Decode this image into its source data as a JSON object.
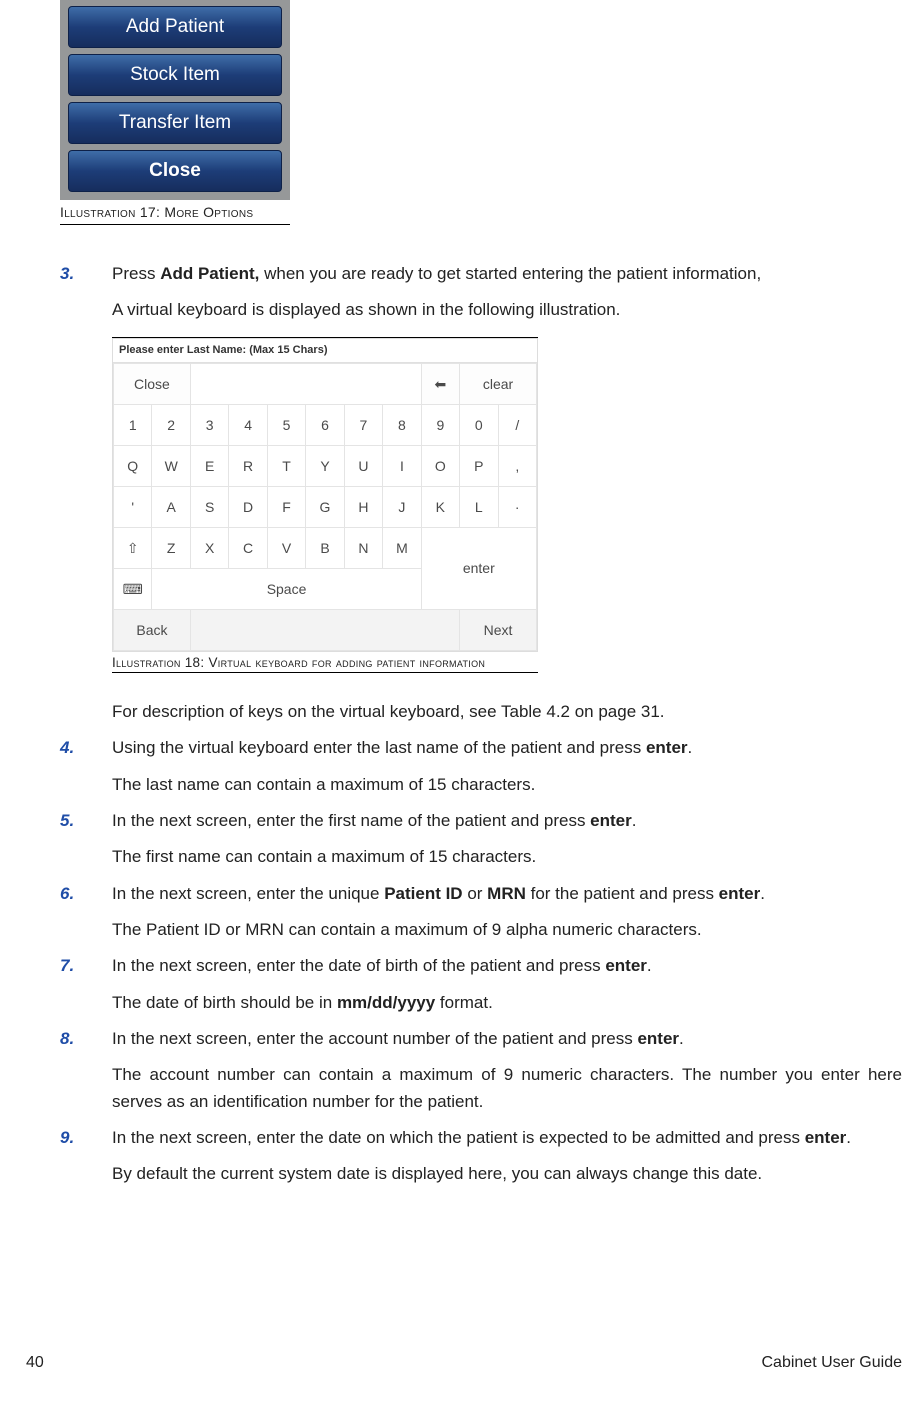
{
  "illustration17": {
    "buttons": [
      "Add Patient",
      "Stock Item",
      "Transfer Item",
      "Close"
    ],
    "caption": "Illustration 17: More Options"
  },
  "steps": {
    "s3": {
      "num": "3.",
      "text_a": "Press ",
      "bold_a": "Add Patient,",
      "text_b": " when you are ready to get started entering the patient information,",
      "line2": "A virtual keyboard is displayed as shown in the following illustration."
    },
    "s3_after": "For description of keys on the virtual keyboard, see Table 4.2 on page 31.",
    "s4": {
      "num": "4.",
      "line1a": "Using the virtual keyboard enter the last name of the patient and press ",
      "line1b": "enter",
      "line1c": ".",
      "line2": "The last name can contain a maximum of 15 characters."
    },
    "s5": {
      "num": "5.",
      "line1a": "In the next screen, enter the first name of the patient and  press  ",
      "line1b": "enter",
      "line1c": ".",
      "line2": "The first name can contain a maximum of 15 characters."
    },
    "s6": {
      "num": "6.",
      "line1a": "In the next screen, enter the unique ",
      "b1": "Patient ID",
      "mid1": " or ",
      "b2": "MRN",
      "mid2": " for the patient and press ",
      "b3": "enter",
      "end": ".",
      "line2": "The Patient ID or MRN  can contain a maximum of 9 alpha numeric characters."
    },
    "s7": {
      "num": "7.",
      "line1a": "In the next screen, enter the date of birth of the patient and press ",
      "line1b": "enter",
      "line1c": ".",
      "line2a": "The date of birth should be in ",
      "line2b": "mm/dd/yyyy",
      "line2c": " format."
    },
    "s8": {
      "num": "8.",
      "line1a": "In the next screen, enter the account number of the patient and press  ",
      "line1b": "enter",
      "line1c": ".",
      "line2": "The account number can contain a maximum of 9 numeric characters. The number you enter here serves as an identification number for the patient."
    },
    "s9": {
      "num": "9.",
      "line1a": "In the next screen, enter the date on which the patient is expected to be admitted and press ",
      "line1b": "enter",
      "line1c": ".",
      "line2": "By default the current system date is displayed here, you can always change this date."
    }
  },
  "illustration18": {
    "header": "Please enter Last Name: (Max 15 Chars)",
    "row1": {
      "close": "Close",
      "bksp": "⬅",
      "clear": "clear"
    },
    "num": [
      "1",
      "2",
      "3",
      "4",
      "5",
      "6",
      "7",
      "8",
      "9",
      "0",
      "/"
    ],
    "r1": [
      "Q",
      "W",
      "E",
      "R",
      "T",
      "Y",
      "U",
      "I",
      "O",
      "P",
      ","
    ],
    "r2": [
      "'",
      "A",
      "S",
      "D",
      "F",
      "G",
      "H",
      "J",
      "K",
      "L",
      "·"
    ],
    "r3": [
      "⇧",
      "Z",
      "X",
      "C",
      "V",
      "B",
      "N",
      "M"
    ],
    "enter": "enter",
    "space_icon": "⌨",
    "space": "Space",
    "back": "Back",
    "next": "Next",
    "caption": "Illustration 18: Virtual keyboard for adding patient information"
  },
  "footer": {
    "page": "40",
    "doc": "Cabinet User Guide"
  }
}
